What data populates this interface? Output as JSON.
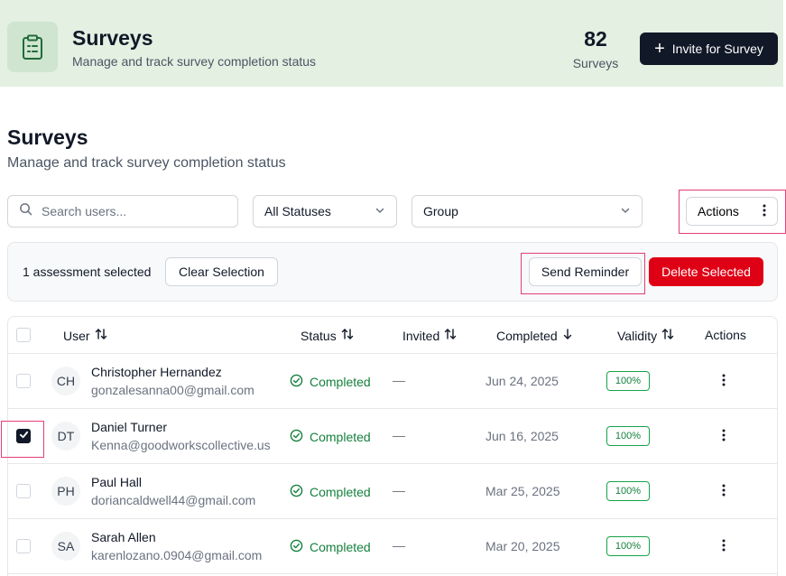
{
  "header": {
    "icon": "clipboard-icon",
    "title": "Surveys",
    "subtitle": "Manage and track survey completion status",
    "stat_value": "82",
    "stat_label": "Surveys",
    "invite_label": "Invite for Survey"
  },
  "page": {
    "title": "Surveys",
    "subtitle": "Manage and track survey completion status"
  },
  "filters": {
    "search_placeholder": "Search users...",
    "status_value": "All Statuses",
    "group_value": "Group",
    "actions_label": "Actions"
  },
  "selection": {
    "count_text": "1 assessment selected",
    "clear_label": "Clear Selection",
    "remind_label": "Send Reminder",
    "delete_label": "Delete Selected"
  },
  "table": {
    "columns": {
      "user": "User",
      "status": "Status",
      "invited": "Invited",
      "completed": "Completed",
      "validity": "Validity",
      "actions": "Actions"
    },
    "rows": [
      {
        "initials": "CH",
        "name": "Christopher Hernandez",
        "email": "gonzalesanna00@gmail.com",
        "status": "Completed",
        "invited": "—",
        "completed": "Jun 24, 2025",
        "validity": "100%",
        "checked": false
      },
      {
        "initials": "DT",
        "name": "Daniel Turner",
        "email": "Kenna@goodworkscollective.us",
        "status": "Completed",
        "invited": "—",
        "completed": "Jun 16, 2025",
        "validity": "100%",
        "checked": true
      },
      {
        "initials": "PH",
        "name": "Paul Hall",
        "email": "doriancaldwell44@gmail.com",
        "status": "Completed",
        "invited": "—",
        "completed": "Mar 25, 2025",
        "validity": "100%",
        "checked": false
      },
      {
        "initials": "SA",
        "name": "Sarah Allen",
        "email": "karenlozano.0904@gmail.com",
        "status": "Completed",
        "invited": "—",
        "completed": "Mar 20, 2025",
        "validity": "100%",
        "checked": false
      }
    ]
  },
  "colors": {
    "header_bg": "#e3f0e2",
    "primary_dark": "#111827",
    "danger": "#e00015",
    "success": "#15803d",
    "highlight": "#e53e77"
  }
}
